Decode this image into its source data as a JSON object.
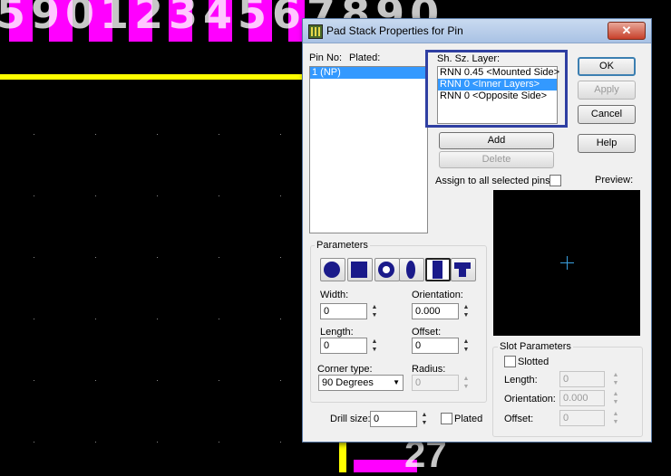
{
  "background": {
    "digits": "5901234567890",
    "bottom_digits": "27"
  },
  "dialog": {
    "title": "Pad Stack Properties for Pin",
    "close_label": "✕",
    "pin_no_label": "Pin No:",
    "plated_label": "Plated:",
    "pins": [
      "1 (NP)"
    ],
    "layer_header": "Sh. Sz. Layer:",
    "layers": [
      "RNN 0.45 <Mounted Side>",
      "RNN 0 <Inner Layers>",
      "RNN 0 <Opposite Side>"
    ],
    "selected_layer_index": 1,
    "ok_label": "OK",
    "apply_label": "Apply",
    "cancel_label": "Cancel",
    "help_label": "Help",
    "add_label": "Add",
    "delete_label": "Delete",
    "assign_all_label": "Assign to all selected pins",
    "preview_label": "Preview:",
    "parameters": {
      "title": "Parameters",
      "shapes": [
        "round-shape-icon",
        "square-shape-icon",
        "annular-shape-icon",
        "oval-shape-icon",
        "rectangle-shape-icon",
        "odd-shape-icon"
      ],
      "width_label": "Width:",
      "width_value": "0",
      "orientation_label": "Orientation:",
      "orientation_value": "0.000",
      "length_label": "Length:",
      "length_value": "0",
      "offset_label": "Offset:",
      "offset_value": "0",
      "corner_type_label": "Corner type:",
      "corner_type_value": "90 Degrees",
      "radius_label": "Radius:",
      "radius_value": "0"
    },
    "drill_size_label": "Drill size:",
    "drill_size_value": "0",
    "drill_plated_label": "Plated",
    "slot": {
      "title": "Slot Parameters",
      "slotted_label": "Slotted",
      "length_label": "Length:",
      "length_value": "0",
      "orientation_label": "Orientation:",
      "orientation_value": "0.000",
      "offset_label": "Offset:",
      "offset_value": "0"
    }
  }
}
